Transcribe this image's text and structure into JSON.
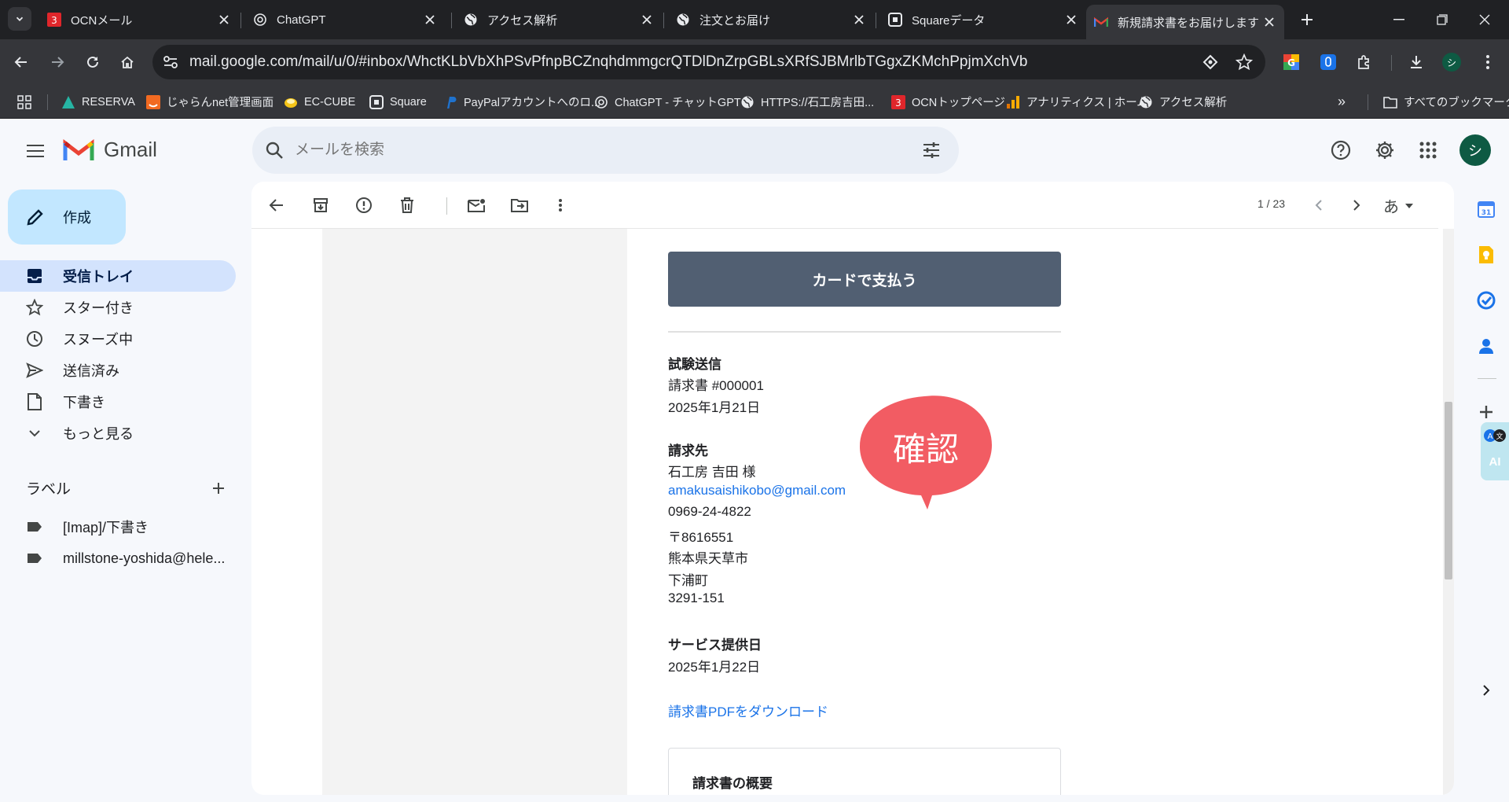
{
  "browser": {
    "tabs": [
      {
        "title": "OCNメール",
        "icon": "ocn-icon",
        "active": false
      },
      {
        "title": "ChatGPT",
        "icon": "chatgpt-icon",
        "active": false
      },
      {
        "title": "アクセス解析",
        "icon": "globe-icon",
        "active": false
      },
      {
        "title": "注文とお届け",
        "icon": "globe-icon",
        "active": false
      },
      {
        "title": "Squareデータ",
        "icon": "square-icon",
        "active": false
      },
      {
        "title": "新規請求書をお届けします",
        "icon": "gmail-icon",
        "active": true
      }
    ],
    "url": "mail.google.com/mail/u/0/#inbox/WhctKLbVbXhPSvPfnpBCZnqhdmmgcrQTDlDnZrpGBLsXRfSJBMrlbTGgxZKMchPpjmXchVb",
    "profile_initial": "シ",
    "bookmarks": [
      {
        "label": "RESERVA",
        "icon": "reserva-icon"
      },
      {
        "label": "じゃらんnet管理画面",
        "icon": "jalan-icon"
      },
      {
        "label": "EC-CUBE",
        "icon": "eccube-icon"
      },
      {
        "label": "Square",
        "icon": "square-icon"
      },
      {
        "label": "PayPalアカウントへのロ...",
        "icon": "paypal-icon"
      },
      {
        "label": "ChatGPT - チャットGPT",
        "icon": "chatgpt-icon"
      },
      {
        "label": "HTTPS://石工房吉田...",
        "icon": "globe-icon"
      },
      {
        "label": "OCNトップページ",
        "icon": "ocn-icon"
      },
      {
        "label": "アナリティクス | ホーム",
        "icon": "analytics-icon"
      },
      {
        "label": "アクセス解析",
        "icon": "globe-icon"
      }
    ],
    "all_bookmarks": "すべてのブックマーク",
    "more_bookmarks": "»"
  },
  "gmail": {
    "logo_text": "Gmail",
    "search_placeholder": "メールを検索",
    "compose_label": "作成",
    "nav": [
      {
        "label": "受信トレイ",
        "icon": "inbox-icon",
        "active": true
      },
      {
        "label": "スター付き",
        "icon": "star-icon",
        "active": false
      },
      {
        "label": "スヌーズ中",
        "icon": "clock-icon",
        "active": false
      },
      {
        "label": "送信済み",
        "icon": "send-icon",
        "active": false
      },
      {
        "label": "下書き",
        "icon": "draft-icon",
        "active": false
      },
      {
        "label": "もっと見る",
        "icon": "chevron-down-icon",
        "active": false
      }
    ],
    "labels_heading": "ラベル",
    "labels": [
      {
        "label": "[Imap]/下書き"
      },
      {
        "label": "millstone-yoshida@hele..."
      }
    ],
    "avatar_initial": "シ",
    "pagination": "1 / 23",
    "input_tool": "あ",
    "ai_badge": "AI",
    "colors": {
      "accent": "#0b57d0",
      "active_nav": "#d3e3fd",
      "compose": "#c2e7ff",
      "pay_button": "#515f72",
      "stamp": "#f25c63",
      "link": "#1a73e8"
    }
  },
  "email": {
    "pay_button": "カードで支払う",
    "sender_heading": "試験送信",
    "invoice_number": "請求書 #000001",
    "invoice_date": "2025年1月21日",
    "billto_heading": "請求先",
    "billto": {
      "name": "石工房 吉田 様",
      "email": "amakusaishikobo@gmail.com",
      "phone": "0969-24-4822",
      "postal": "〒8616551",
      "prefecture": "熊本県天草市",
      "town": "下浦町",
      "address": "3291-151"
    },
    "service_heading": "サービス提供日",
    "service_date": "2025年1月22日",
    "pdf_link": "請求書PDFをダウンロード",
    "summary_heading": "請求書の概要",
    "stamp_text": "確認"
  }
}
